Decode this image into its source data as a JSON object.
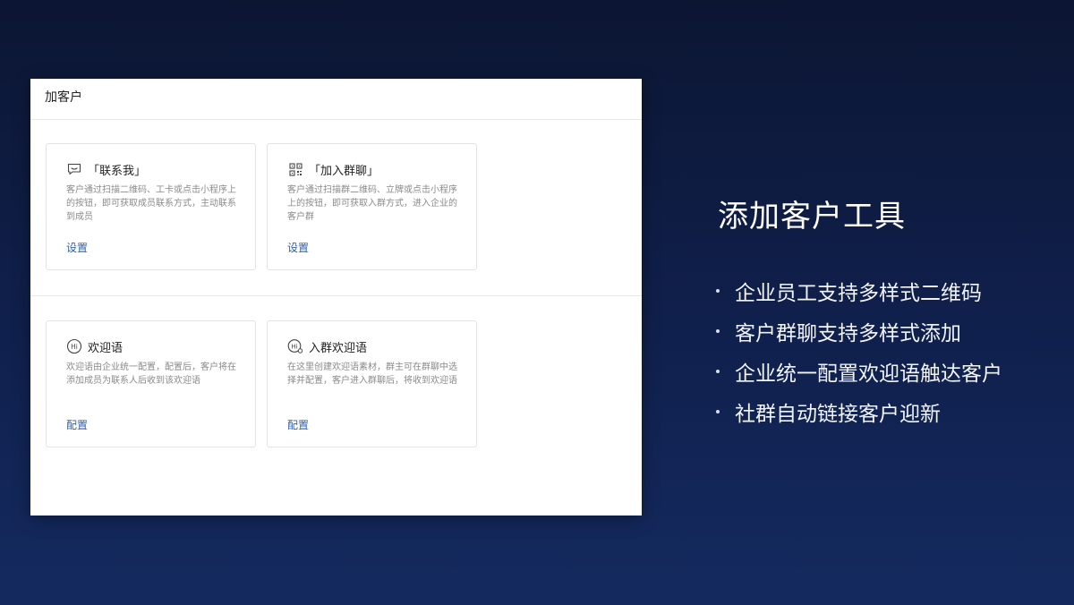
{
  "panel": {
    "title": "加客户",
    "cards": [
      {
        "icon": "chat-bubble-icon",
        "title": "「联系我」",
        "description": "客户通过扫描二维码、工卡或点击小程序上的按钮，即可获取成员联系方式，主动联系到成员",
        "link": "设置"
      },
      {
        "icon": "qr-code-icon",
        "title": "「加入群聊」",
        "description": "客户通过扫描群二维码、立牌或点击小程序上的按钮，即可获取入群方式，进入企业的客户群",
        "link": "设置"
      },
      {
        "icon": "hi-greeting-icon",
        "title": "欢迎语",
        "description": "欢迎语由企业统一配置，配置后，客户将在添加成员为联系人后收到该欢迎语",
        "link": "配置"
      },
      {
        "icon": "hi-group-greeting-icon",
        "title": "入群欢迎语",
        "description": "在这里创建欢迎语素材，群主可在群聊中选择并配置，客户进入群聊后，将收到欢迎语",
        "link": "配置"
      }
    ]
  },
  "headline": "添加客户工具",
  "bullets": [
    "企业员工支持多样式二维码",
    "客户群聊支持多样式添加",
    "企业统一配置欢迎语触达客户",
    "社群自动链接客户迎新"
  ],
  "colors": {
    "background": "#0e1a3c",
    "link": "#2f5fa8",
    "headline": "#ffffff"
  }
}
